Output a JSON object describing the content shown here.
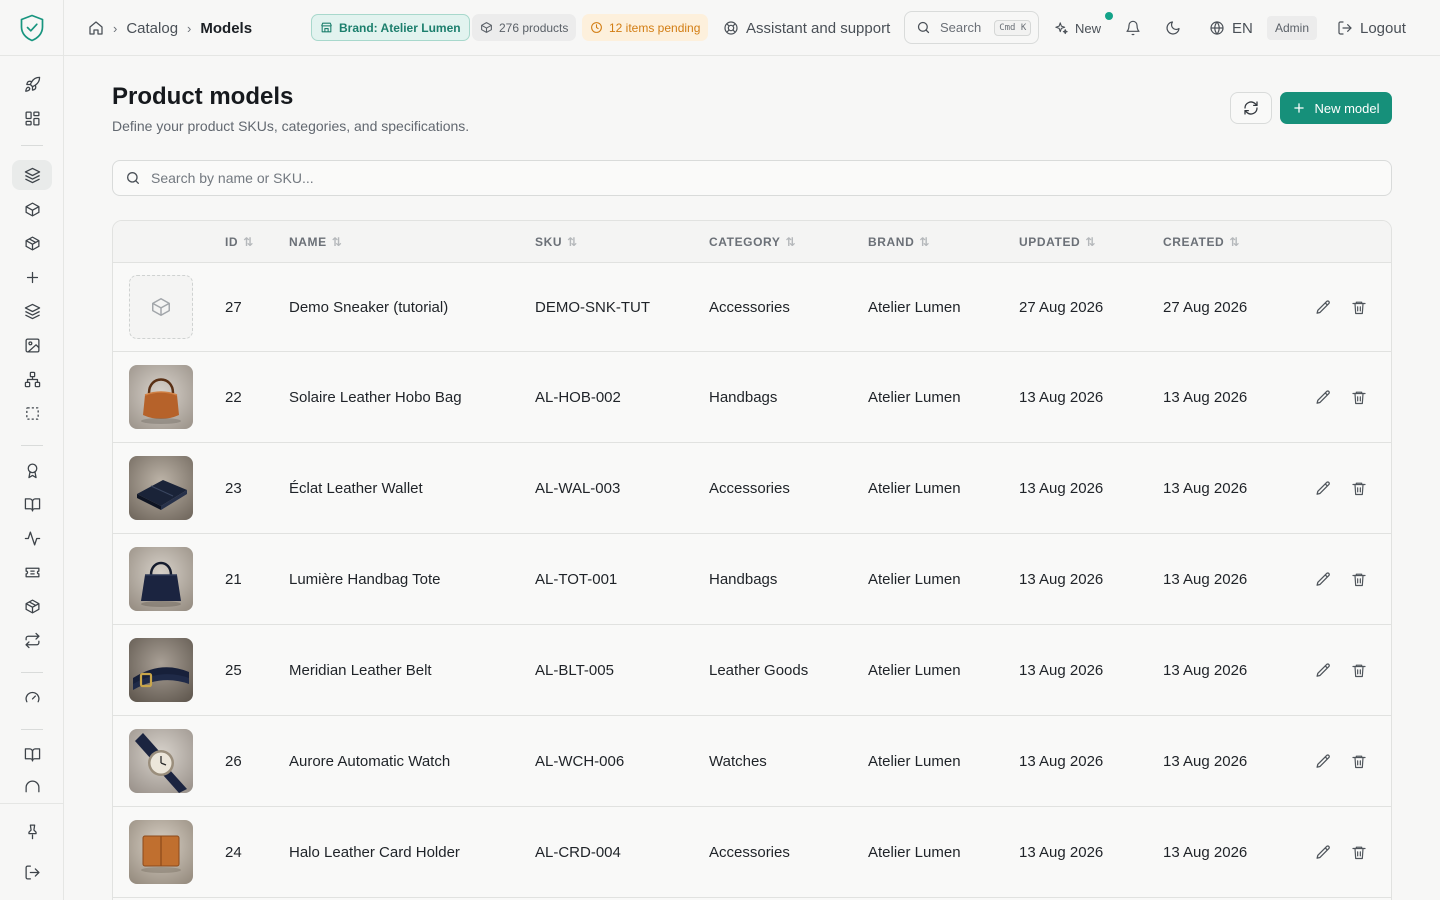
{
  "topbar": {
    "breadcrumb": {
      "home_icon": "home-icon",
      "catalog": "Catalog",
      "current": "Models"
    },
    "brand_pill": "Brand: Atelier Lumen",
    "products_pill": "276 products",
    "pending_pill": "12 items pending",
    "assistant": "Assistant and support",
    "search_label": "Search",
    "search_shortcut": "Cmd K",
    "new_label": "New",
    "language": "EN",
    "role": "Admin",
    "logout": "Logout"
  },
  "sidebar": {
    "icons": [
      "rocket-icon",
      "dashboard-icon",
      "layers-icon",
      "box-icon",
      "package-icon",
      "plus-icon",
      "layers-alt-icon",
      "image-icon",
      "hierarchy-icon",
      "selection-icon",
      "award-icon",
      "book-icon",
      "activity-icon",
      "ticket-icon",
      "package-alt-icon",
      "repeat-icon",
      "gauge-icon",
      "book-open-icon",
      "headphones-icon",
      "pin-icon",
      "sign-out-icon"
    ]
  },
  "page": {
    "title": "Product models",
    "subtitle": "Define your product SKUs, categories, and specifications.",
    "new_button": "New model",
    "search_placeholder": "Search by name or SKU..."
  },
  "table": {
    "columns": [
      "ID",
      "NAME",
      "SKU",
      "CATEGORY",
      "BRAND",
      "UPDATED",
      "CREATED"
    ],
    "rows": [
      {
        "id": "27",
        "name": "Demo Sneaker (tutorial)",
        "sku": "DEMO-SNK-TUT",
        "category": "Accessories",
        "brand": "Atelier Lumen",
        "updated": "27 Aug 2026",
        "created": "27 Aug 2026",
        "image": "placeholder-box"
      },
      {
        "id": "22",
        "name": "Solaire Leather Hobo Bag",
        "sku": "AL-HOB-002",
        "category": "Handbags",
        "brand": "Atelier Lumen",
        "updated": "13 Aug 2026",
        "created": "13 Aug 2026",
        "image": "hobo-bag"
      },
      {
        "id": "23",
        "name": "Éclat Leather Wallet",
        "sku": "AL-WAL-003",
        "category": "Accessories",
        "brand": "Atelier Lumen",
        "updated": "13 Aug 2026",
        "created": "13 Aug 2026",
        "image": "wallet"
      },
      {
        "id": "21",
        "name": "Lumière Handbag Tote",
        "sku": "AL-TOT-001",
        "category": "Handbags",
        "brand": "Atelier Lumen",
        "updated": "13 Aug 2026",
        "created": "13 Aug 2026",
        "image": "tote"
      },
      {
        "id": "25",
        "name": "Meridian Leather Belt",
        "sku": "AL-BLT-005",
        "category": "Leather Goods",
        "brand": "Atelier Lumen",
        "updated": "13 Aug 2026",
        "created": "13 Aug 2026",
        "image": "belt"
      },
      {
        "id": "26",
        "name": "Aurore Automatic Watch",
        "sku": "AL-WCH-006",
        "category": "Watches",
        "brand": "Atelier Lumen",
        "updated": "13 Aug 2026",
        "created": "13 Aug 2026",
        "image": "watch"
      },
      {
        "id": "24",
        "name": "Halo Leather Card Holder",
        "sku": "AL-CRD-004",
        "category": "Accessories",
        "brand": "Atelier Lumen",
        "updated": "13 Aug 2026",
        "created": "13 Aug 2026",
        "image": "card-holder"
      }
    ]
  },
  "colors": {
    "accent": "#16907a",
    "brand_pill_bg": "#e2f3ef",
    "pending": "#d27d13",
    "notification_dot": "#14a389"
  }
}
